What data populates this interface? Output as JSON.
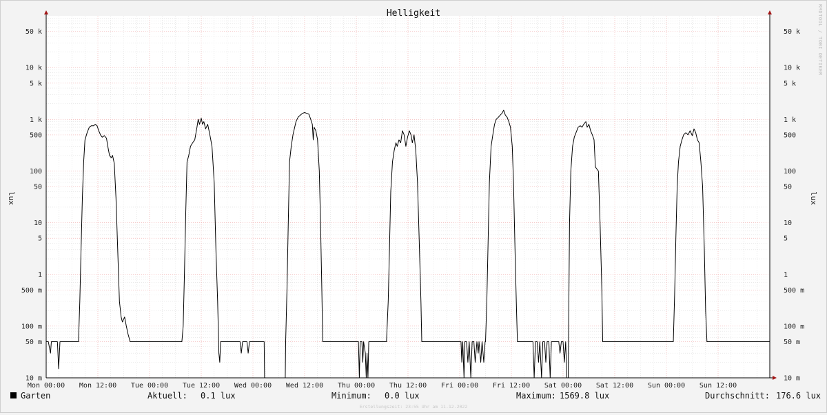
{
  "chart_data": {
    "type": "line",
    "title": "Helligkeit",
    "ylabel": "lux",
    "yscale": "log",
    "ylim": [
      0.01,
      100000
    ],
    "y_tick_labels": [
      "10 m",
      "50 m",
      "100 m",
      "500 m",
      "1",
      "5",
      "10",
      "50",
      "100",
      "500",
      "1 k",
      "5 k",
      "10 k",
      "50 k"
    ],
    "y_tick_values": [
      0.01,
      0.05,
      0.1,
      0.5,
      1,
      5,
      10,
      50,
      100,
      500,
      1000,
      5000,
      10000,
      50000
    ],
    "x_tick_labels": [
      "Mon 00:00",
      "Mon 12:00",
      "Tue 00:00",
      "Tue 12:00",
      "Wed 00:00",
      "Wed 12:00",
      "Thu 00:00",
      "Thu 12:00",
      "Fri 00:00",
      "Fri 12:00",
      "Sat 00:00",
      "Sat 12:00",
      "Sun 00:00",
      "Sun 12:00"
    ],
    "x_unit": "hours since Mon 00:00",
    "xlim": [
      0,
      168
    ],
    "grid": true,
    "series": [
      {
        "name": "Garten",
        "color": "#000000",
        "points": [
          [
            0,
            0.05
          ],
          [
            0.5,
            0.05
          ],
          [
            1,
            0.03
          ],
          [
            1.2,
            0.05
          ],
          [
            2,
            0.05
          ],
          [
            2.6,
            0.05
          ],
          [
            2.9,
            0.015
          ],
          [
            3.2,
            0.05
          ],
          [
            4,
            0.05
          ],
          [
            5,
            0.05
          ],
          [
            6,
            0.05
          ],
          [
            7,
            0.05
          ],
          [
            7.5,
            0.05
          ],
          [
            7.8,
            0.3
          ],
          [
            8.1,
            3
          ],
          [
            8.4,
            30
          ],
          [
            8.7,
            150
          ],
          [
            9,
            400
          ],
          [
            9.5,
            550
          ],
          [
            10,
            700
          ],
          [
            10.5,
            750
          ],
          [
            11,
            750
          ],
          [
            11.4,
            800
          ],
          [
            11.8,
            750
          ],
          [
            12.2,
            600
          ],
          [
            12.6,
            500
          ],
          [
            13,
            450
          ],
          [
            13.5,
            480
          ],
          [
            14,
            430
          ],
          [
            14.3,
            300
          ],
          [
            14.7,
            200
          ],
          [
            15.1,
            180
          ],
          [
            15.4,
            200
          ],
          [
            15.8,
            140
          ],
          [
            16.2,
            30
          ],
          [
            16.6,
            3
          ],
          [
            17,
            0.3
          ],
          [
            17.4,
            0.15
          ],
          [
            17.7,
            0.12
          ],
          [
            18.2,
            0.15
          ],
          [
            18.6,
            0.1
          ],
          [
            19,
            0.07
          ],
          [
            19.5,
            0.05
          ],
          [
            20,
            0.05
          ],
          [
            24,
            0.05
          ],
          [
            30,
            0.05
          ],
          [
            31.5,
            0.05
          ],
          [
            31.8,
            0.1
          ],
          [
            32.1,
            1
          ],
          [
            32.4,
            15
          ],
          [
            32.7,
            150
          ],
          [
            33.1,
            200
          ],
          [
            33.5,
            300
          ],
          [
            34,
            350
          ],
          [
            34.5,
            400
          ],
          [
            35,
            700
          ],
          [
            35.3,
            1000
          ],
          [
            35.6,
            800
          ],
          [
            36,
            1050
          ],
          [
            36.3,
            800
          ],
          [
            36.6,
            900
          ],
          [
            37,
            650
          ],
          [
            37.5,
            800
          ],
          [
            38,
            500
          ],
          [
            38.5,
            300
          ],
          [
            39,
            60
          ],
          [
            39.4,
            3
          ],
          [
            39.8,
            0.3
          ],
          [
            40.1,
            0.03
          ],
          [
            40.3,
            0.02
          ],
          [
            40.5,
            0.05
          ],
          [
            42,
            0.05
          ],
          [
            44,
            0.05
          ],
          [
            45,
            0.05
          ],
          [
            45.3,
            0.03
          ],
          [
            45.6,
            0.05
          ],
          [
            46.6,
            0.05
          ],
          [
            46.9,
            0.03
          ],
          [
            47.2,
            0.05
          ],
          [
            48,
            0.05
          ],
          [
            50,
            0.05
          ],
          [
            50.6,
            0.05
          ],
          [
            50.7,
            0.01
          ],
          [
            55.5,
            0.01
          ],
          [
            55.6,
            0.05
          ],
          [
            55.9,
            0.5
          ],
          [
            56.2,
            10
          ],
          [
            56.5,
            150
          ],
          [
            56.9,
            300
          ],
          [
            57.3,
            500
          ],
          [
            57.7,
            700
          ],
          [
            58,
            900
          ],
          [
            58.5,
            1100
          ],
          [
            59,
            1200
          ],
          [
            59.5,
            1300
          ],
          [
            60,
            1350
          ],
          [
            60.5,
            1300
          ],
          [
            61,
            1250
          ],
          [
            61.4,
            1000
          ],
          [
            61.8,
            800
          ],
          [
            62,
            400
          ],
          [
            62.2,
            700
          ],
          [
            62.6,
            600
          ],
          [
            63,
            400
          ],
          [
            63.4,
            100
          ],
          [
            63.7,
            10
          ],
          [
            64,
            0.5
          ],
          [
            64.2,
            0.05
          ],
          [
            66,
            0.05
          ],
          [
            68,
            0.05
          ],
          [
            70,
            0.05
          ],
          [
            72,
            0.05
          ],
          [
            72.5,
            0.05
          ],
          [
            72.7,
            0.01
          ],
          [
            72.9,
            0.05
          ],
          [
            73.3,
            0.05
          ],
          [
            73.5,
            0.02
          ],
          [
            73.7,
            0.05
          ],
          [
            74.1,
            0.03
          ],
          [
            74.3,
            0.01
          ],
          [
            74.5,
            0.03
          ],
          [
            74.7,
            0.01
          ],
          [
            74.9,
            0.05
          ],
          [
            75.4,
            0.05
          ],
          [
            76,
            0.05
          ],
          [
            78,
            0.05
          ],
          [
            79,
            0.05
          ],
          [
            79.4,
            0.3
          ],
          [
            79.7,
            3
          ],
          [
            80,
            40
          ],
          [
            80.4,
            150
          ],
          [
            80.8,
            250
          ],
          [
            81.2,
            350
          ],
          [
            81.5,
            300
          ],
          [
            81.9,
            400
          ],
          [
            82.3,
            350
          ],
          [
            82.7,
            600
          ],
          [
            83.1,
            500
          ],
          [
            83.5,
            300
          ],
          [
            83.9,
            450
          ],
          [
            84.3,
            600
          ],
          [
            84.7,
            500
          ],
          [
            85,
            350
          ],
          [
            85.4,
            500
          ],
          [
            85.8,
            250
          ],
          [
            86.2,
            60
          ],
          [
            86.6,
            5
          ],
          [
            87,
            0.3
          ],
          [
            87.2,
            0.05
          ],
          [
            90,
            0.05
          ],
          [
            92,
            0.05
          ],
          [
            95,
            0.05
          ],
          [
            96,
            0.05
          ],
          [
            96.3,
            0.05
          ],
          [
            96.5,
            0.02
          ],
          [
            96.7,
            0.05
          ],
          [
            97,
            0.01
          ],
          [
            97.2,
            0.05
          ],
          [
            97.6,
            0.05
          ],
          [
            97.9,
            0.02
          ],
          [
            98.2,
            0.05
          ],
          [
            98.6,
            0.01
          ],
          [
            98.9,
            0.05
          ],
          [
            99.3,
            0.05
          ],
          [
            99.6,
            0.02
          ],
          [
            100,
            0.05
          ],
          [
            100.3,
            0.03
          ],
          [
            100.5,
            0.05
          ],
          [
            100.9,
            0.02
          ],
          [
            101.2,
            0.05
          ],
          [
            101.6,
            0.02
          ],
          [
            101.9,
            0.05
          ],
          [
            102,
            0.05
          ],
          [
            102.3,
            0.3
          ],
          [
            102.6,
            4
          ],
          [
            102.9,
            60
          ],
          [
            103.3,
            300
          ],
          [
            103.7,
            500
          ],
          [
            104.1,
            800
          ],
          [
            104.5,
            1000
          ],
          [
            105,
            1100
          ],
          [
            105.4,
            1200
          ],
          [
            105.8,
            1300
          ],
          [
            106.2,
            1500
          ],
          [
            106.6,
            1200
          ],
          [
            107,
            1100
          ],
          [
            107.4,
            900
          ],
          [
            107.8,
            700
          ],
          [
            108.2,
            300
          ],
          [
            108.5,
            60
          ],
          [
            108.9,
            2
          ],
          [
            109.2,
            0.2
          ],
          [
            109.4,
            0.05
          ],
          [
            110,
            0.05
          ],
          [
            112,
            0.05
          ],
          [
            113,
            0.05
          ],
          [
            113.3,
            0.01
          ],
          [
            113.6,
            0.05
          ],
          [
            114,
            0.05
          ],
          [
            114.3,
            0.02
          ],
          [
            114.6,
            0.05
          ],
          [
            115,
            0.01
          ],
          [
            115.3,
            0.05
          ],
          [
            115.7,
            0.05
          ],
          [
            116,
            0.02
          ],
          [
            116.3,
            0.05
          ],
          [
            116.7,
            0.05
          ],
          [
            117,
            0.01
          ],
          [
            117.3,
            0.05
          ],
          [
            118.5,
            0.05
          ],
          [
            119,
            0.05
          ],
          [
            119.3,
            0.03
          ],
          [
            119.6,
            0.05
          ],
          [
            120,
            0.05
          ],
          [
            120.3,
            0.02
          ],
          [
            120.6,
            0.05
          ],
          [
            120.9,
            0.01
          ],
          [
            121.2,
            0.01
          ],
          [
            121.5,
            10
          ],
          [
            121.8,
            100
          ],
          [
            122.2,
            300
          ],
          [
            122.6,
            450
          ],
          [
            123,
            550
          ],
          [
            123.5,
            700
          ],
          [
            124,
            750
          ],
          [
            124.4,
            700
          ],
          [
            124.8,
            800
          ],
          [
            125.3,
            900
          ],
          [
            125.6,
            700
          ],
          [
            126,
            800
          ],
          [
            126.4,
            600
          ],
          [
            126.8,
            500
          ],
          [
            127.2,
            400
          ],
          [
            127.5,
            120
          ],
          [
            127.8,
            110
          ],
          [
            128.2,
            100
          ],
          [
            128.6,
            10
          ],
          [
            129,
            0.5
          ],
          [
            129.2,
            0.05
          ],
          [
            132,
            0.05
          ],
          [
            136,
            0.05
          ],
          [
            140,
            0.05
          ],
          [
            144,
            0.05
          ],
          [
            145.6,
            0.05
          ],
          [
            145.9,
            0.4
          ],
          [
            146.2,
            5
          ],
          [
            146.5,
            50
          ],
          [
            146.8,
            150
          ],
          [
            147.2,
            300
          ],
          [
            147.6,
            400
          ],
          [
            148,
            500
          ],
          [
            148.5,
            550
          ],
          [
            149,
            500
          ],
          [
            149.5,
            600
          ],
          [
            150,
            480
          ],
          [
            150.4,
            650
          ],
          [
            150.8,
            550
          ],
          [
            151.2,
            400
          ],
          [
            151.6,
            350
          ],
          [
            152,
            150
          ],
          [
            152.4,
            50
          ],
          [
            152.8,
            3
          ],
          [
            153.1,
            0.2
          ],
          [
            153.4,
            0.05
          ],
          [
            156,
            0.05
          ],
          [
            160,
            0.05
          ],
          [
            164,
            0.05
          ],
          [
            168,
            0.05
          ]
        ]
      }
    ],
    "legend": {
      "position": "bottom-left",
      "entries": [
        {
          "name": "Garten",
          "color": "#000000"
        }
      ]
    }
  },
  "stats": {
    "current": {
      "label": "Aktuell:",
      "value": "0.1 lux"
    },
    "minimum": {
      "label": "Minimum:",
      "value": "0.0 lux"
    },
    "maximum": {
      "label": "Maximum:",
      "value": "1569.8 lux"
    },
    "average": {
      "label": "Durchschnitt:",
      "value": "176.6 lux"
    }
  },
  "watermark": "RRDTOOL / TOBI OETIKER",
  "footer": "Erstellungszeit: 23:55 Uhr am 11.12.2022"
}
